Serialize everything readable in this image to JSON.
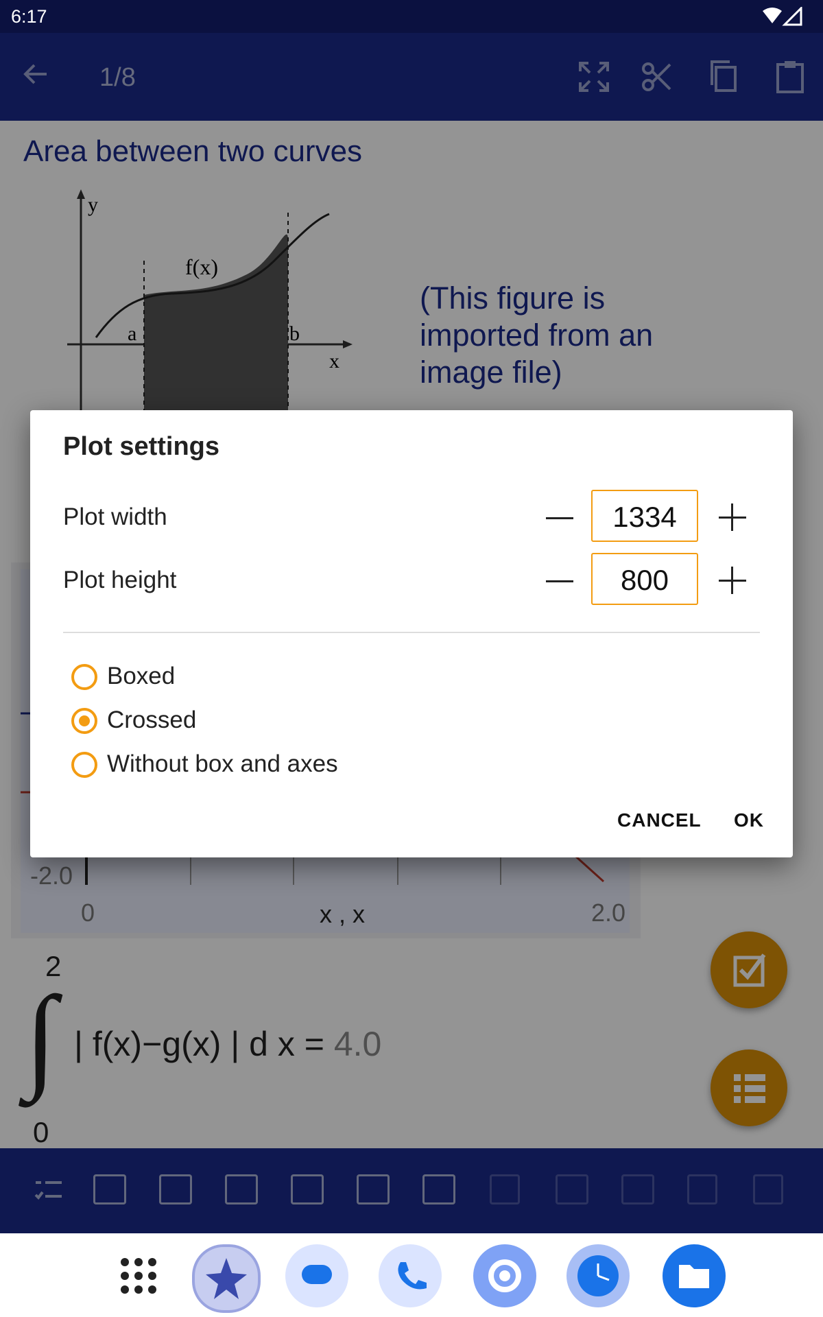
{
  "status_bar": {
    "time": "6:17"
  },
  "app_bar": {
    "page_position": "1/8",
    "icons": [
      "back-arrow-icon",
      "fit-screen-icon",
      "cut-icon",
      "copy-icon",
      "paste-icon"
    ]
  },
  "document": {
    "title": "Area between two curves",
    "figure_caption": "(This figure is imported from an image file)",
    "figure_labels": {
      "y": "y",
      "x": "x",
      "f": "f(x)",
      "a": "a",
      "b": "b"
    },
    "plot": {
      "y_tick_min": "-2.0",
      "x_tick_min": "0",
      "x_tick_max": "2.0",
      "x_label": "x , x"
    },
    "integral": {
      "upper": "2",
      "lower": "0",
      "integrand": "| f(x)−g(x) | d x =",
      "result": "4.0"
    }
  },
  "dialog": {
    "title": "Plot settings",
    "width_label": "Plot width",
    "width_value": "1334",
    "height_label": "Plot height",
    "height_value": "800",
    "options": [
      {
        "label": "Boxed",
        "checked": false
      },
      {
        "label": "Crossed",
        "checked": true
      },
      {
        "label": "Without box and axes",
        "checked": false
      }
    ],
    "cancel_label": "CANCEL",
    "ok_label": "OK"
  },
  "fabs": [
    "check-icon",
    "list-icon"
  ],
  "bottom_toolbar": [
    "checklist-icon",
    "equation-define-icon",
    "equation-evaluate-icon",
    "plot-icon",
    "plot-parametric-icon",
    "text-icon",
    "image-icon",
    "bar-icon",
    "ellipsis-bracket-icon",
    "matrix-icon",
    "block-icon",
    "paren-icon"
  ],
  "nav_dock": [
    "app-drawer-icon",
    "app-icon",
    "messages-icon",
    "phone-icon",
    "settings-icon",
    "clock-icon",
    "files-icon"
  ],
  "colors": {
    "primary": "#1b2a8a",
    "accent": "#f39c12",
    "fab": "#d98f08"
  }
}
